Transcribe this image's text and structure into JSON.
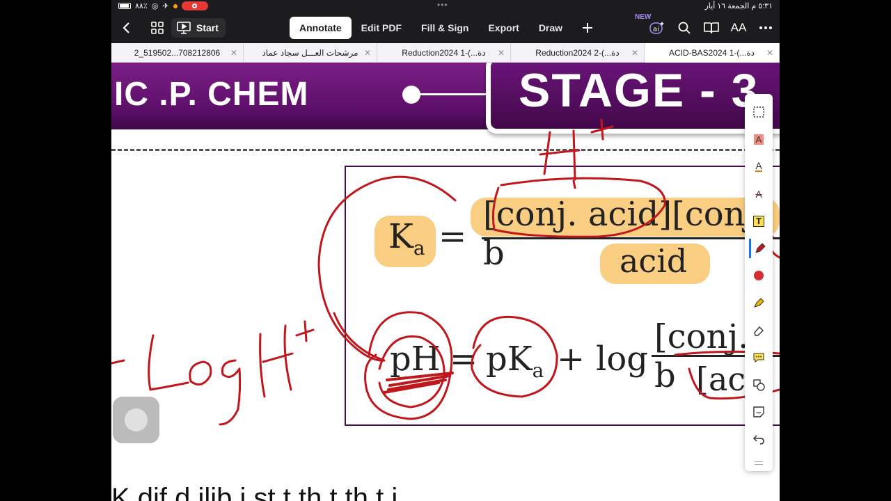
{
  "status": {
    "battery": "٨٨٪",
    "time_date": "٥:٣١ م  الجمعة ١٦ أيار",
    "handle": "•••"
  },
  "toolbar": {
    "start_label": "Start",
    "modes": [
      {
        "label": "Annotate",
        "active": true
      },
      {
        "label": "Edit PDF",
        "active": false
      },
      {
        "label": "Fill & Sign",
        "active": false
      },
      {
        "label": "Export",
        "active": false
      },
      {
        "label": "Draw",
        "active": false
      }
    ],
    "new_badge": "NEW",
    "ai_label": "ai",
    "text_size_label": "AA"
  },
  "doc_tabs": [
    {
      "label": "2_519502...708212806",
      "active": false
    },
    {
      "label": "مرشحات العـــل سجاد عماد",
      "active": false
    },
    {
      "label": "Reduction2024 دة...)-1",
      "active": false
    },
    {
      "label": "Reduction2024 دة...)-2",
      "active": false
    },
    {
      "label": "ACID-BAS2024 دة...)-1",
      "active": true
    }
  ],
  "page": {
    "banner_left": "IC .P. CHEM",
    "banner_stage": "STAGE - 3",
    "ka_symbol": "K",
    "ka_sub": "a",
    "equals": "=",
    "numerator": "[conj. acid][conj. b",
    "denominator": "acid",
    "ph": "pH",
    "pka": "pK",
    "pka_sub": "a",
    "plus": "+",
    "log": "log",
    "hh_numerator": "[conj. b",
    "hh_denominator": "[aci",
    "bottom_text": "Κ              dif    d    ilib        i        st   t th t  th   t i"
  },
  "palette": [
    {
      "icon": "selection-rect-icon",
      "selected": false
    },
    {
      "icon": "highlight-text-icon",
      "selected": false
    },
    {
      "icon": "underline-text-icon",
      "selected": false
    },
    {
      "icon": "strikethrough-text-icon",
      "selected": false
    },
    {
      "icon": "text-box-icon",
      "selected": false
    },
    {
      "icon": "pen-icon",
      "selected": true
    },
    {
      "icon": "red-color-icon",
      "selected": false
    },
    {
      "icon": "highlighter-icon",
      "selected": false
    },
    {
      "icon": "eraser-icon",
      "selected": false
    },
    {
      "icon": "comment-icon",
      "selected": false
    },
    {
      "icon": "shapes-icon",
      "selected": false
    },
    {
      "icon": "sticker-icon",
      "selected": false
    },
    {
      "icon": "undo-icon",
      "selected": false
    }
  ],
  "colors": {
    "accent": "#1a73e8",
    "ink": "#c0171d",
    "banner": "#6a157a",
    "highlight": "#f7be5a"
  }
}
